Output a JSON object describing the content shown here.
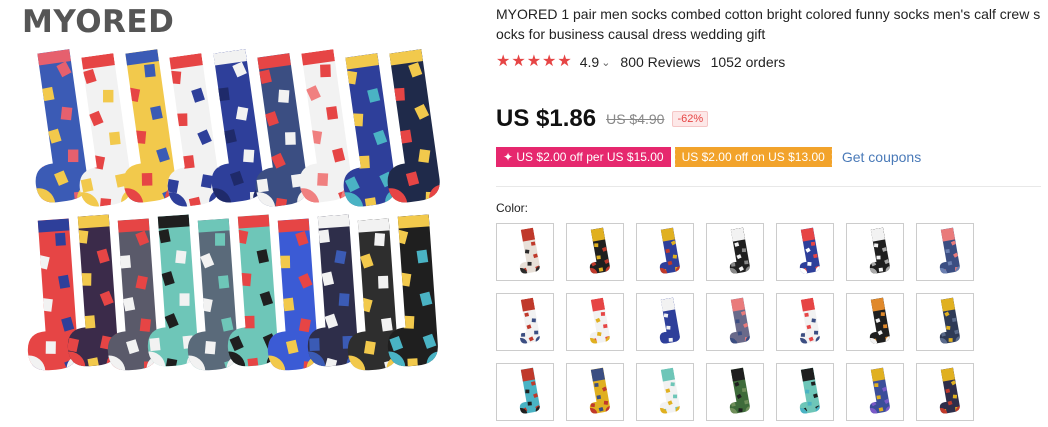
{
  "brand": {
    "logo_text": "MYORED"
  },
  "product": {
    "title": "MYORED 1 pair men socks combed cotton bright colored funny socks men's calf crew socks for business causal dress wedding gift",
    "rating": "4.9",
    "reviews": "800 Reviews",
    "orders": "1052 orders"
  },
  "price": {
    "current": "US $1.86",
    "original": "US $4.90",
    "discount": "-62%"
  },
  "coupons": {
    "store_coupon": "✦ US $2.00 off per US $15.00",
    "select_coupon": "US $2.00 off on US $13.00",
    "get_coupons": "Get coupons"
  },
  "color": {
    "label": "Color:",
    "options": [
      {
        "colors": [
          "#e8e0d8",
          "#c0392b",
          "#2b2b2b"
        ]
      },
      {
        "colors": [
          "#1f1f1f",
          "#e0b020",
          "#c0392b"
        ]
      },
      {
        "colors": [
          "#2e3f9a",
          "#e0b020",
          "#c0392b"
        ]
      },
      {
        "colors": [
          "#1f1f1f",
          "#f2f2f2",
          "#888888"
        ]
      },
      {
        "colors": [
          "#2e3f9a",
          "#e64545",
          "#ffffff"
        ]
      },
      {
        "colors": [
          "#1f1f1f",
          "#f2f2f2",
          "#aaaaaa"
        ]
      },
      {
        "colors": [
          "#3b4e82",
          "#e97b7b",
          "#6a7fb0"
        ]
      },
      {
        "colors": [
          "#f2f2f2",
          "#c0392b",
          "#3b4e82"
        ]
      },
      {
        "colors": [
          "#f2f2f2",
          "#e64545",
          "#e0b020"
        ]
      },
      {
        "colors": [
          "#2e3f9a",
          "#f2f2f2",
          "#2e3f9a"
        ]
      },
      {
        "colors": [
          "#6a6a8a",
          "#e97b7b",
          "#3b4e82"
        ]
      },
      {
        "colors": [
          "#f2f2f2",
          "#e64545",
          "#3b4e82"
        ]
      },
      {
        "colors": [
          "#1f1f1f",
          "#e0892b",
          "#f2f2f2"
        ]
      },
      {
        "colors": [
          "#2e3a56",
          "#e0b020",
          "#5a6a8a"
        ]
      },
      {
        "colors": [
          "#4ab3c4",
          "#c0392b",
          "#1f1f1f"
        ]
      },
      {
        "colors": [
          "#e0b020",
          "#3b4e82",
          "#c0392b"
        ]
      },
      {
        "colors": [
          "#f2f2f2",
          "#6ec6b8",
          "#e0b020"
        ]
      },
      {
        "colors": [
          "#3e6b3a",
          "#1f1f1f",
          "#6f8f5a"
        ]
      },
      {
        "colors": [
          "#6ec6b8",
          "#1f1f1f",
          "#4ab3c4"
        ]
      },
      {
        "colors": [
          "#3b4e9a",
          "#e0b020",
          "#7a5ac8"
        ]
      },
      {
        "colors": [
          "#2e2e4a",
          "#e0b020",
          "#c0392b"
        ]
      }
    ]
  },
  "image_socks": {
    "top_row": [
      {
        "colors": [
          "#3b5bb5",
          "#e6606e",
          "#f2c94c"
        ]
      },
      {
        "colors": [
          "#f2f2f2",
          "#e64545",
          "#f2c94c"
        ]
      },
      {
        "colors": [
          "#f2c94c",
          "#3b5bb5",
          "#e64545"
        ]
      },
      {
        "colors": [
          "#f2f2f2",
          "#e64545",
          "#2e3f9a"
        ]
      },
      {
        "colors": [
          "#2e3f9a",
          "#f2f2f2",
          "#1f2a6a"
        ]
      },
      {
        "colors": [
          "#3b4e82",
          "#e64545",
          "#f2f2f2"
        ]
      },
      {
        "colors": [
          "#f2f2f2",
          "#e64545",
          "#f08080"
        ]
      },
      {
        "colors": [
          "#2e3f9a",
          "#f2c94c",
          "#4ab3c4"
        ]
      },
      {
        "colors": [
          "#1f2a4a",
          "#f2c94c",
          "#e64545"
        ]
      }
    ],
    "bottom_row": [
      {
        "colors": [
          "#e64545",
          "#2e3f9a",
          "#f2f2f2"
        ]
      },
      {
        "colors": [
          "#3b2b4a",
          "#f2c94c",
          "#e64545"
        ]
      },
      {
        "colors": [
          "#5a5a6a",
          "#e64545",
          "#f2f2f2"
        ]
      },
      {
        "colors": [
          "#6ec6b8",
          "#1f1f1f",
          "#f2f2f2"
        ]
      },
      {
        "colors": [
          "#5a6a7a",
          "#6ec6b8",
          "#f2f2f2"
        ]
      },
      {
        "colors": [
          "#6ec6b8",
          "#e64545",
          "#1f1f1f"
        ]
      },
      {
        "colors": [
          "#3b5bd5",
          "#e64545",
          "#f2c94c"
        ]
      },
      {
        "colors": [
          "#2e2e4a",
          "#f2f2f2",
          "#3b5bb5"
        ]
      },
      {
        "colors": [
          "#2e2e2e",
          "#f2f2f2",
          "#f2c94c"
        ]
      },
      {
        "colors": [
          "#1f1f1f",
          "#f2c94c",
          "#4ab3c4"
        ]
      }
    ]
  }
}
